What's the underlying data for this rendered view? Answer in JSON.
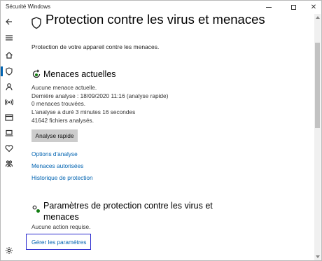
{
  "window": {
    "title": "Sécurité Windows"
  },
  "page": {
    "title": "Protection contre les virus et menaces",
    "subtitle": "Protection de votre appareil contre les menaces."
  },
  "current_threats": {
    "heading": "Menaces actuelles",
    "lines": [
      "Aucune menace actuelle.",
      "Dernière analyse : 18/09/2020 11:16 (analyse rapide)",
      "0 menaces trouvées.",
      "L'analyse a duré 3 minutes 16 secondes",
      "41642 fichiers analysés."
    ],
    "quick_scan_label": "Analyse rapide",
    "links": [
      "Options d'analyse",
      "Menaces autorisées",
      "Historique de protection"
    ]
  },
  "protection_settings": {
    "heading": "Paramètres de protection contre les virus et menaces",
    "status": "Aucune action requise.",
    "manage_link": "Gérer les paramètres"
  },
  "nav": {
    "icons": [
      "back-arrow-icon",
      "hamburger-menu-icon",
      "home-icon",
      "shield-icon",
      "account-icon",
      "wifi-antenna-icon",
      "app-browser-icon",
      "laptop-icon",
      "heart-icon",
      "family-icon",
      "settings-gear-icon"
    ]
  },
  "colors": {
    "accent": "#0063b1",
    "button_bg": "#cccccc",
    "focus_outline": "#2a2acf"
  }
}
